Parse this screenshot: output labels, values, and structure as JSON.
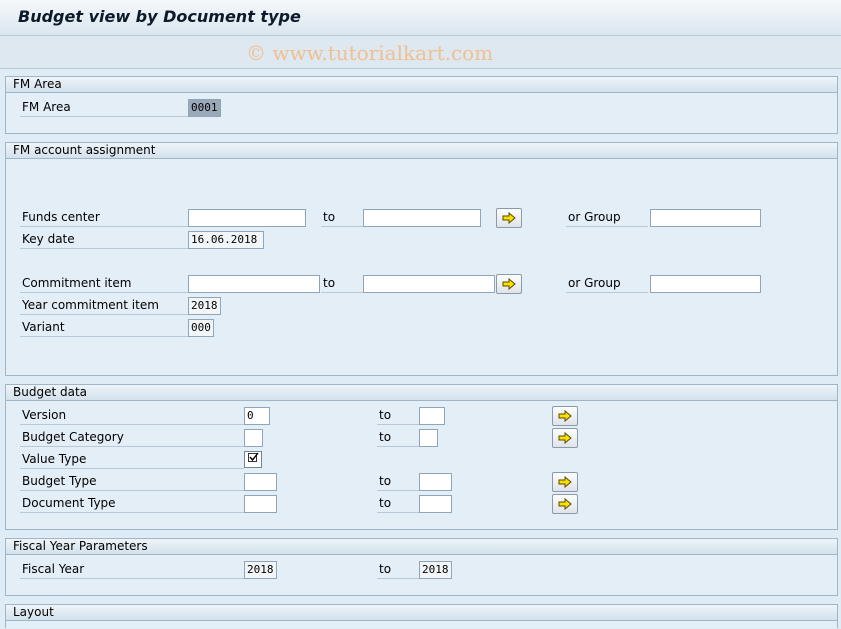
{
  "window": {
    "title": "Budget view by Document type"
  },
  "watermark": "© www.tutorialkart.com",
  "groups": {
    "fm_area": {
      "title": "FM Area",
      "fm_area_label": "FM Area",
      "fm_area_value": "0001"
    },
    "fm_account": {
      "title": "FM account assignment",
      "funds_center_label": "Funds center",
      "funds_center_from": "",
      "funds_center_to": "",
      "to_label": "to",
      "or_group_label": "or Group",
      "funds_center_group": "",
      "key_date_label": "Key date",
      "key_date_value": "16.06.2018",
      "commitment_item_label": "Commitment item",
      "commitment_item_from": "",
      "commitment_item_to": "",
      "commitment_item_group": "",
      "year_commitment_item_label": "Year commitment item",
      "year_commitment_item_value": "2018",
      "variant_label": "Variant",
      "variant_value": "000"
    },
    "budget_data": {
      "title": "Budget data",
      "to_label": "to",
      "version_label": "Version",
      "version_from": "0",
      "version_to": "",
      "budget_category_label": "Budget Category",
      "budget_category_from": "",
      "budget_category_to": "",
      "value_type_label": "Value Type",
      "value_type_checked": true,
      "budget_type_label": "Budget Type",
      "budget_type_from": "",
      "budget_type_to": "",
      "document_type_label": "Document Type",
      "document_type_from": "",
      "document_type_to": ""
    },
    "fiscal_year": {
      "title": "Fiscal Year Parameters",
      "fiscal_year_label": "Fiscal Year",
      "fiscal_year_from": "2018",
      "to_label": "to",
      "fiscal_year_to": "2018"
    },
    "layout": {
      "title": "Layout"
    }
  },
  "icons": {
    "multiple_selection": "arrow-right-icon"
  },
  "colors": {
    "background": "#dfebf5",
    "group_border": "#9fb6c9",
    "arrow_yellow": "#f6e000"
  }
}
